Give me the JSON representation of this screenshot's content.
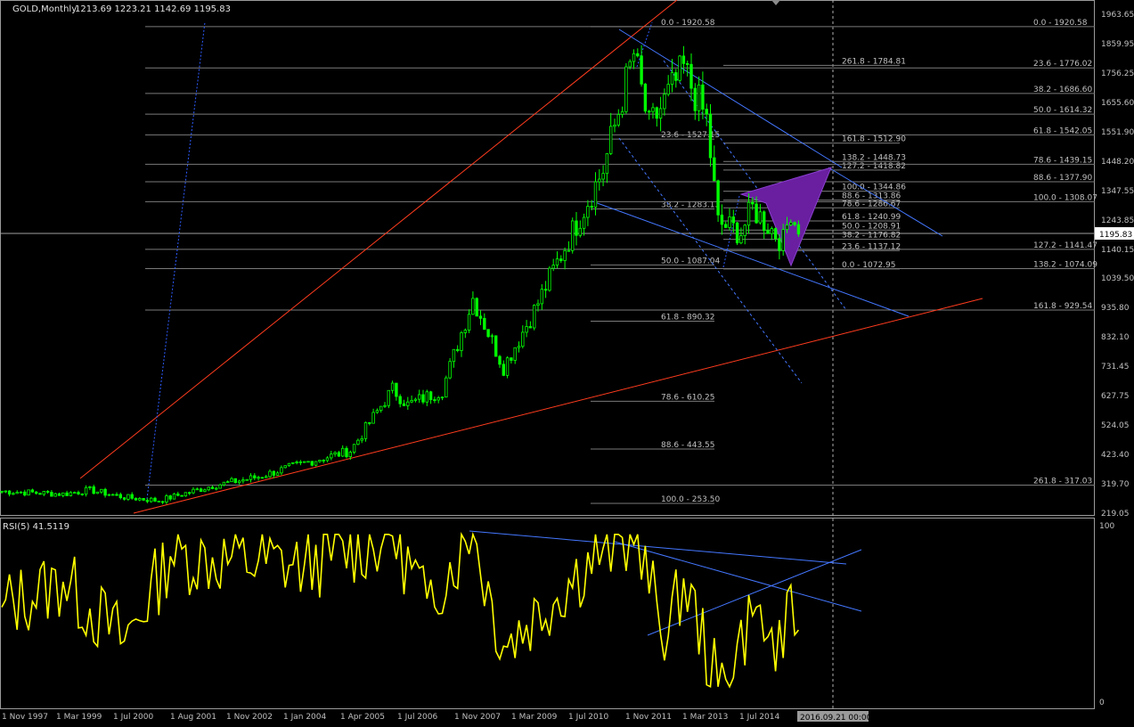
{
  "header": {
    "symbol": "GOLD,Monthly",
    "ohlc": "1213.69 1223.21 1142.69 1195.83"
  },
  "rsi_header": "RSI(5) 41.5119",
  "colors": {
    "background": "#000000",
    "grid": "#808080",
    "candles": "#00ff00",
    "rsi": "#ffff00",
    "trendline_red": "#ff3c1e",
    "trendline_blue": "#2e5cff",
    "pattern": "#6a1fa0",
    "price_tag": "#ffffff"
  },
  "chart_data": [
    {
      "type": "candlestick",
      "title": "GOLD,Monthly",
      "y_ticks": [
        "1963.65",
        "1859.95",
        "1756.25",
        "1655.60",
        "1551.90",
        "1448.20",
        "1347.55",
        "1243.85",
        "1140.15",
        "1039.50",
        "935.80",
        "832.10",
        "731.45",
        "627.75",
        "524.05",
        "423.40",
        "319.70",
        "219.05"
      ],
      "ylim": [
        219.05,
        1963.65
      ],
      "x_ticks": [
        "1 Nov 1997",
        "1 Mar 1999",
        "1 Jul 2000",
        "1 Aug 2001",
        "1 Nov 2002",
        "1 Jan 2004",
        "1 Apr 2005",
        "1 Jul 2006",
        "1 Nov 2007",
        "1 Mar 2009",
        "1 Jul 2010",
        "1 Nov 2011",
        "1 Mar 2013",
        "1 Jul 2014"
      ],
      "x_marker": "2016.09.21 00:00",
      "current_price": "1195.83",
      "monthly_close_anchors": [
        {
          "date": "1997-11",
          "close": 296
        },
        {
          "date": "1999-03",
          "close": 286
        },
        {
          "date": "1999-10",
          "close": 300
        },
        {
          "date": "2000-07",
          "close": 275
        },
        {
          "date": "2001-04",
          "close": 263
        },
        {
          "date": "2002-06",
          "close": 315
        },
        {
          "date": "2003-06",
          "close": 346
        },
        {
          "date": "2004-06",
          "close": 395
        },
        {
          "date": "2005-06",
          "close": 437
        },
        {
          "date": "2006-05",
          "close": 653
        },
        {
          "date": "2006-09",
          "close": 598
        },
        {
          "date": "2007-06",
          "close": 650
        },
        {
          "date": "2008-02",
          "close": 971
        },
        {
          "date": "2008-10",
          "close": 730
        },
        {
          "date": "2009-06",
          "close": 927
        },
        {
          "date": "2009-12",
          "close": 1096
        },
        {
          "date": "2010-12",
          "close": 1421
        },
        {
          "date": "2011-08",
          "close": 1826
        },
        {
          "date": "2011-12",
          "close": 1565
        },
        {
          "date": "2012-09",
          "close": 1772
        },
        {
          "date": "2013-03",
          "close": 1595
        },
        {
          "date": "2013-06",
          "close": 1234
        },
        {
          "date": "2013-12",
          "close": 1202
        },
        {
          "date": "2014-03",
          "close": 1284
        },
        {
          "date": "2014-11",
          "close": 1168
        },
        {
          "date": "2015-01",
          "close": 1283
        },
        {
          "date": "2015-03",
          "close": 1195
        }
      ],
      "fib_labels_left": [
        {
          "text": "0.0 - 1920.58",
          "price": 1920.58
        },
        {
          "text": "23.6 - 1527.15",
          "price": 1527.15
        },
        {
          "text": "38.2 - 1283.13",
          "price": 1283.13
        },
        {
          "text": "50.0 - 1087.04",
          "price": 1087.04
        },
        {
          "text": "61.8 - 890.32",
          "price": 890.32
        },
        {
          "text": "78.6 - 610.25",
          "price": 610.25
        },
        {
          "text": "88.6 - 443.55",
          "price": 443.55
        },
        {
          "text": "100.0 - 253.50",
          "price": 253.5
        }
      ],
      "fib_labels_mid": [
        {
          "text": "261.8 - 1784.81",
          "price": 1784.81
        },
        {
          "text": "161.8 - 1512.90",
          "price": 1512.9
        },
        {
          "text": "138.2 - 1448.73",
          "price": 1448.73
        },
        {
          "text": "127.2 - 1418.82",
          "price": 1418.82
        },
        {
          "text": "100.0 - 1344.86",
          "price": 1344.86
        },
        {
          "text": "88.6 - 1313.86",
          "price": 1313.86
        },
        {
          "text": "78.6 - 1286.67",
          "price": 1286.67
        },
        {
          "text": "61.8 - 1240.99",
          "price": 1240.99
        },
        {
          "text": "50.0 - 1208.91",
          "price": 1208.91
        },
        {
          "text": "38.2 - 1176.82",
          "price": 1176.82
        },
        {
          "text": "23.6 - 1137.12",
          "price": 1137.12
        },
        {
          "text": "0.0 - 1072.95",
          "price": 1072.95
        }
      ],
      "fib_labels_right": [
        {
          "text": "0.0 - 1920.58",
          "price": 1920.58
        },
        {
          "text": "23.6 - 1776.02",
          "price": 1776.02
        },
        {
          "text": "38.2 - 1686.60",
          "price": 1686.6
        },
        {
          "text": "50.0 - 1614.32",
          "price": 1614.32
        },
        {
          "text": "61.8 - 1542.05",
          "price": 1542.05
        },
        {
          "text": "78.6 - 1439.15",
          "price": 1439.15
        },
        {
          "text": "88.6 - 1377.90",
          "price": 1377.9
        },
        {
          "text": "100.0 - 1308.07",
          "price": 1308.07
        },
        {
          "text": "127.2 - 1141.47",
          "price": 1141.47
        },
        {
          "text": "138.2 - 1074.09",
          "price": 1074.09
        },
        {
          "text": "161.8 - 929.54",
          "price": 929.54
        },
        {
          "text": "261.8 - 317.03",
          "price": 317.03
        }
      ]
    },
    {
      "type": "line",
      "title": "RSI(5) 41.5119",
      "y_ticks": [
        "100",
        "0"
      ],
      "ylim": [
        0,
        100
      ],
      "last_value": 41.5119,
      "anchors": [
        {
          "date": "1997-11",
          "value": 55
        },
        {
          "date": "1999-03",
          "value": 70
        },
        {
          "date": "2000-07",
          "value": 35
        },
        {
          "date": "2001-07",
          "value": 85
        },
        {
          "date": "2004-06",
          "value": 80
        },
        {
          "date": "2006-05",
          "value": 97
        },
        {
          "date": "2007-02",
          "value": 60
        },
        {
          "date": "2008-02",
          "value": 98
        },
        {
          "date": "2008-10",
          "value": 32
        },
        {
          "date": "2010-12",
          "value": 90
        },
        {
          "date": "2011-08",
          "value": 92
        },
        {
          "date": "2012-05",
          "value": 38
        },
        {
          "date": "2012-09",
          "value": 72
        },
        {
          "date": "2013-06",
          "value": 8
        },
        {
          "date": "2014-03",
          "value": 50
        },
        {
          "date": "2014-11",
          "value": 25
        },
        {
          "date": "2015-01",
          "value": 68
        },
        {
          "date": "2015-03",
          "value": 41.5
        }
      ]
    }
  ]
}
